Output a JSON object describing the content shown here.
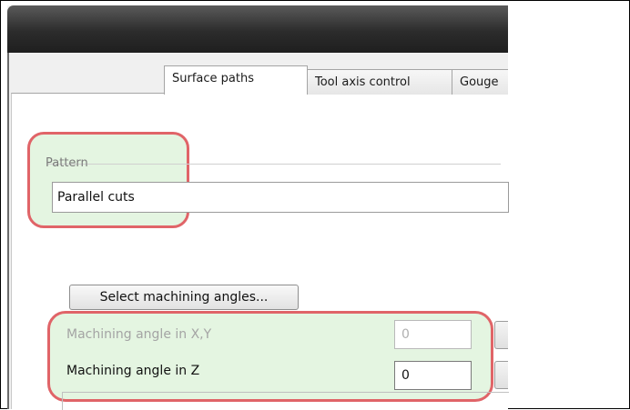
{
  "tabs": [
    {
      "label": "Surface paths",
      "active": true
    },
    {
      "label": "Tool axis control",
      "active": false
    },
    {
      "label": "Gouge",
      "active": false
    }
  ],
  "pattern": {
    "group_label": "Pattern",
    "selected_value": "Parallel cuts"
  },
  "angles": {
    "select_button_label": "Select machining angles...",
    "xy_label": "Machining angle in X,Y",
    "xy_value": "0",
    "xy_disabled": true,
    "z_label": "Machining angle in Z",
    "z_value": "0"
  },
  "colors": {
    "highlight_border": "#e06468",
    "highlight_fill": "#e4f5e1",
    "title_bar": "#2c2c2c"
  }
}
